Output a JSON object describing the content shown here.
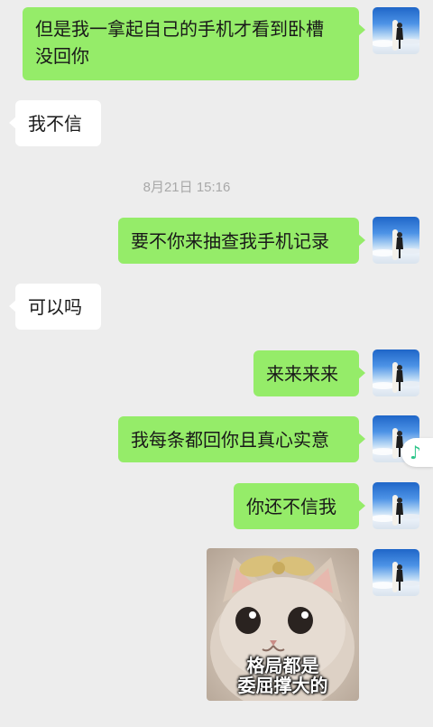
{
  "messages": [
    {
      "side": "me",
      "text_line1": "但是我一拿起自己的手机才看到卧槽",
      "text_line2": "没回你"
    },
    {
      "side": "them",
      "text": "我不信"
    },
    {
      "side": "me",
      "text": "要不你来抽查我手机记录"
    },
    {
      "side": "them",
      "text": "可以吗"
    },
    {
      "side": "me",
      "text": "来来来来"
    },
    {
      "side": "me",
      "text": "我每条都回你且真心实意"
    },
    {
      "side": "me",
      "text": "你还不信我"
    }
  ],
  "timestamp": "8月21日 15:16",
  "sticker": {
    "caption_line1": "格局都是",
    "caption_line2": "委屈撑大的"
  },
  "colors": {
    "me_bubble": "#95ec69",
    "them_bubble": "#ffffff",
    "background": "#ededed",
    "music_note": "#2ec58a"
  },
  "icons": {
    "floating": "music-note-icon"
  }
}
